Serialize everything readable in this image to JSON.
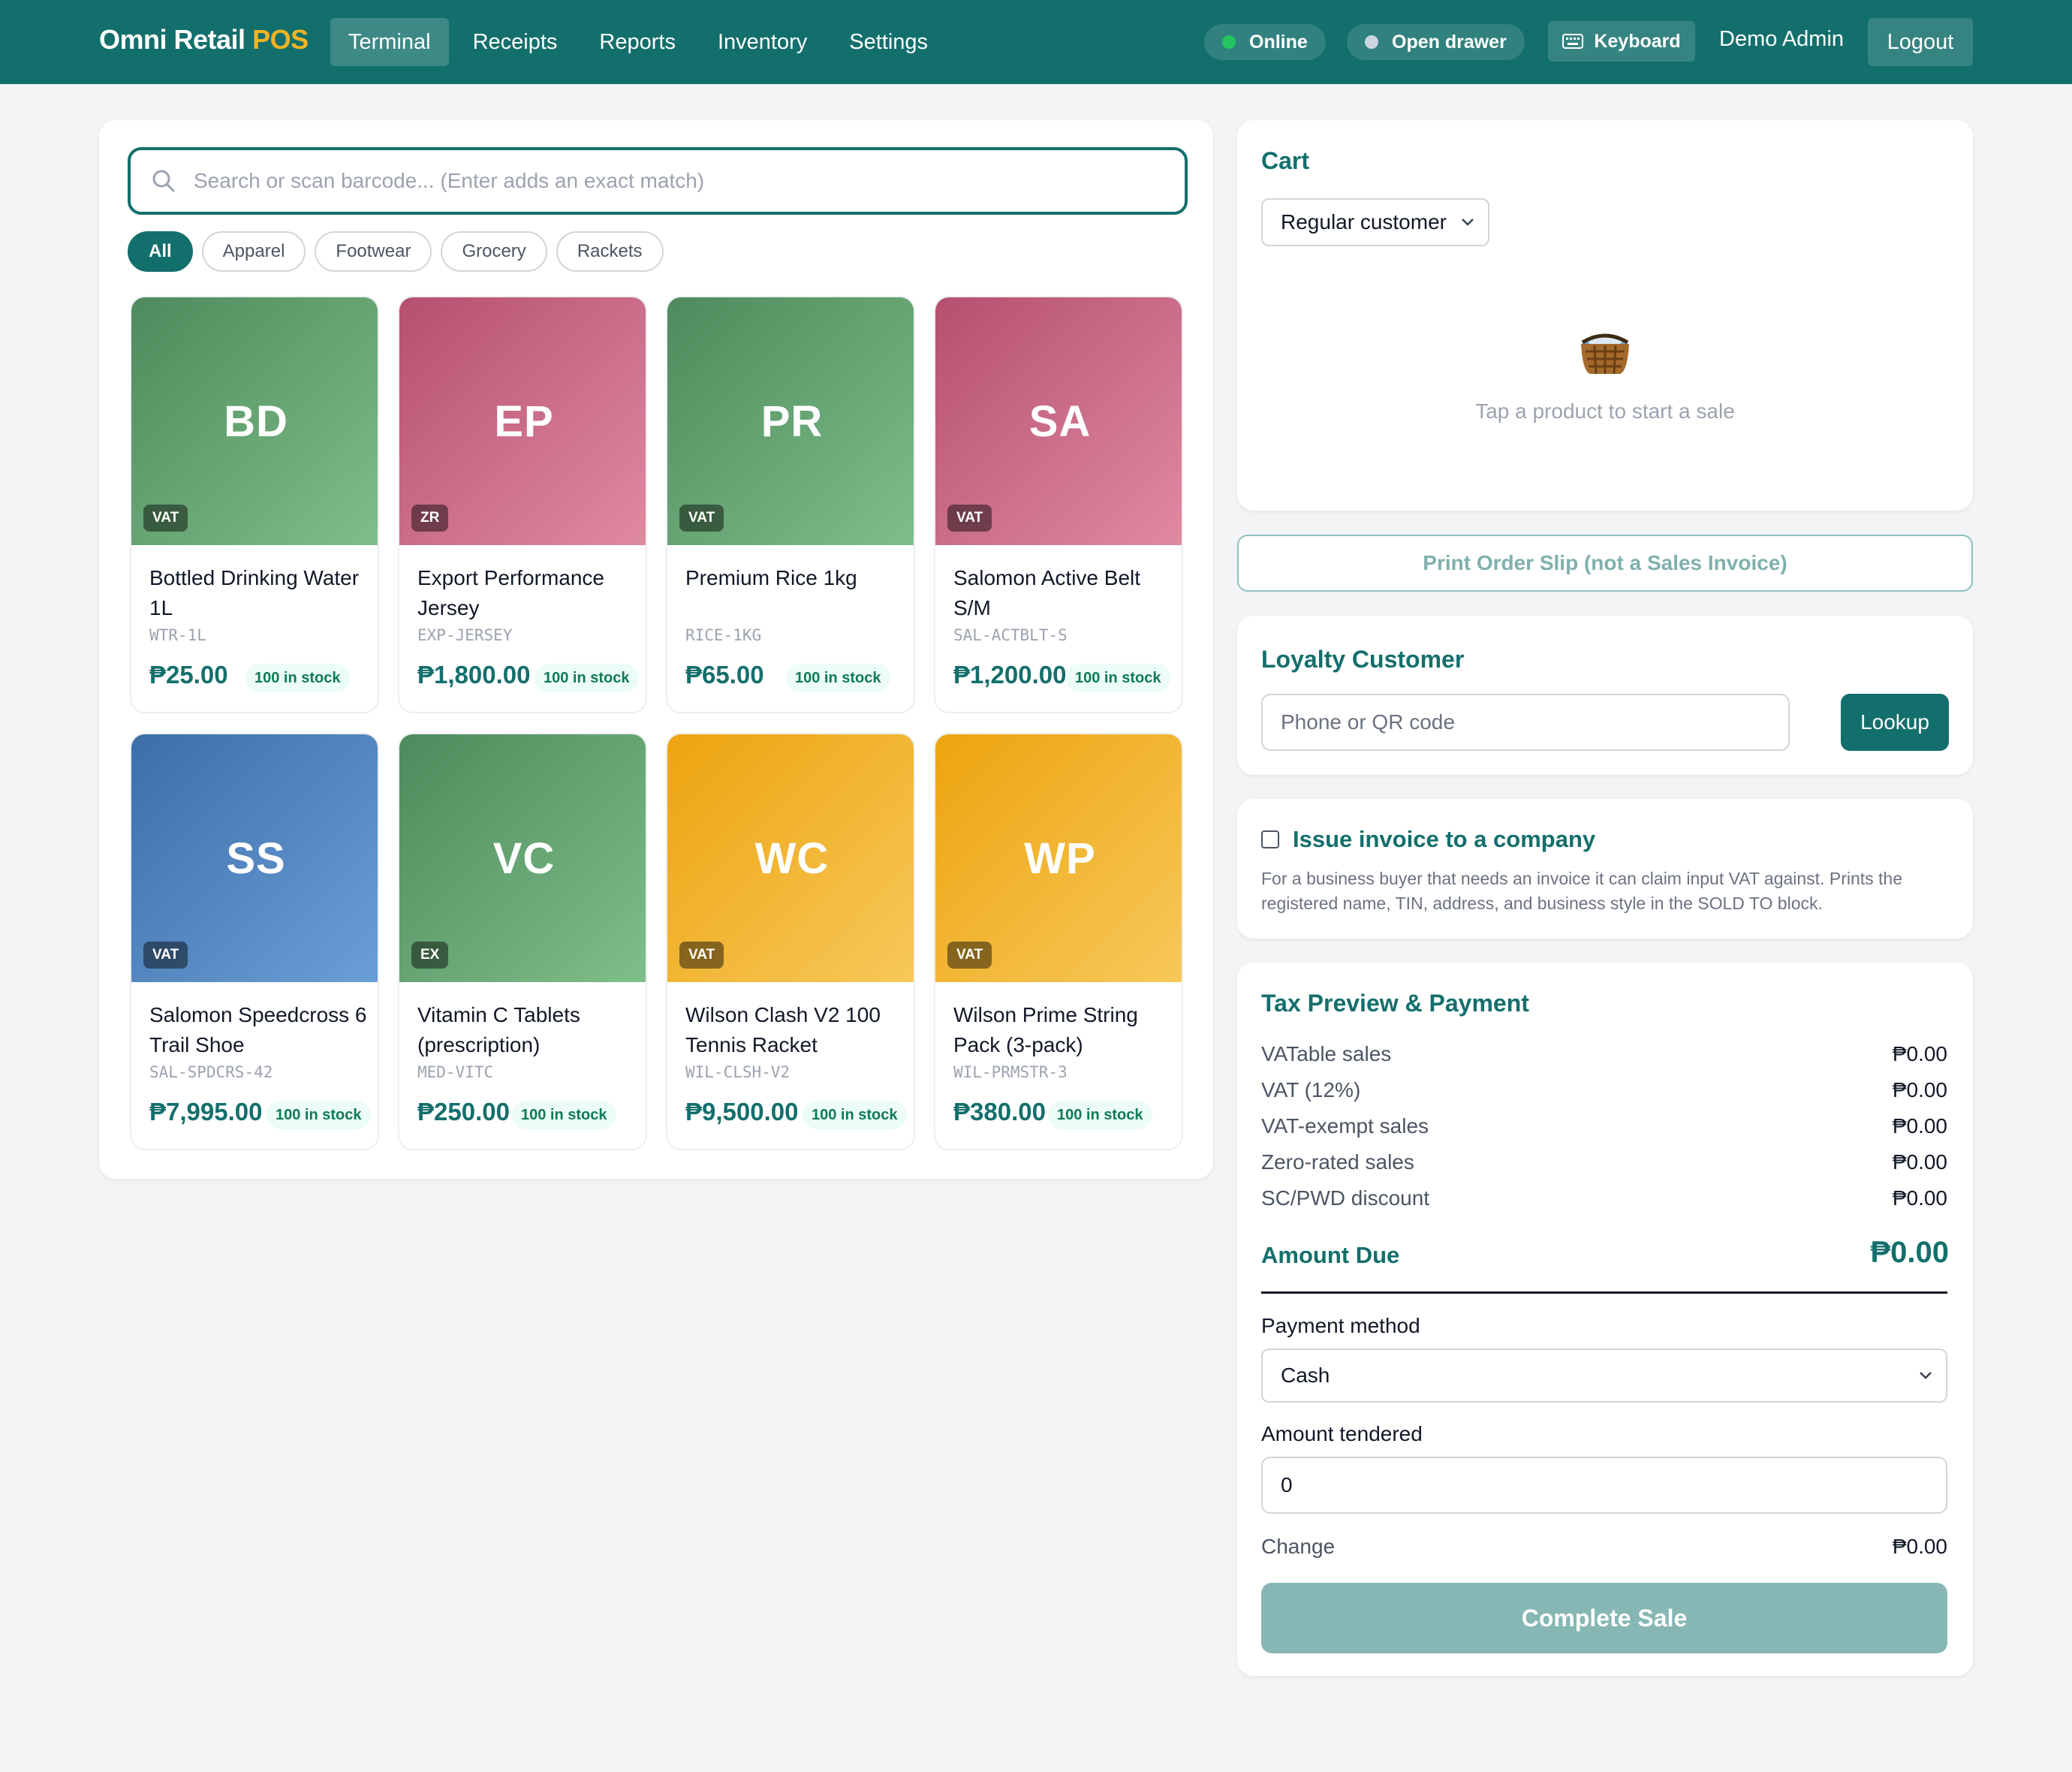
{
  "brand": {
    "name": "Omni Retail",
    "accent": "POS"
  },
  "nav": [
    {
      "label": "Terminal",
      "active": true
    },
    {
      "label": "Receipts"
    },
    {
      "label": "Reports"
    },
    {
      "label": "Inventory"
    },
    {
      "label": "Settings"
    }
  ],
  "status": {
    "online": "Online",
    "drawer": "Open drawer",
    "keyboard": "Keyboard",
    "user": "Demo Admin",
    "logout": "Logout"
  },
  "search": {
    "placeholder": "Search or scan barcode... (Enter adds an exact match)"
  },
  "categories": [
    "All",
    "Apparel",
    "Footwear",
    "Grocery",
    "Rackets"
  ],
  "products": [
    {
      "initials": "BD",
      "tax": "VAT",
      "name": "Bottled Drinking Water 1L",
      "sku": "WTR-1L",
      "price": "₱25.00",
      "stock": "100 in stock"
    },
    {
      "initials": "EP",
      "tax": "ZR",
      "name": "Export Performance Jersey",
      "sku": "EXP-JERSEY",
      "price": "₱1,800.00",
      "stock": "100 in stock"
    },
    {
      "initials": "PR",
      "tax": "VAT",
      "name": "Premium Rice 1kg",
      "sku": "RICE-1KG",
      "price": "₱65.00",
      "stock": "100 in stock"
    },
    {
      "initials": "SA",
      "tax": "VAT",
      "name": "Salomon Active Belt S/M",
      "sku": "SAL-ACTBLT-S",
      "price": "₱1,200.00",
      "stock": "100 in stock"
    },
    {
      "initials": "SS",
      "tax": "VAT",
      "name": "Salomon Speedcross 6 Trail Shoe",
      "sku": "SAL-SPDCRS-42",
      "price": "₱7,995.00",
      "stock": "100 in stock"
    },
    {
      "initials": "VC",
      "tax": "EX",
      "name": "Vitamin C Tablets (prescription)",
      "sku": "MED-VITC",
      "price": "₱250.00",
      "stock": "100 in stock"
    },
    {
      "initials": "WC",
      "tax": "VAT",
      "name": "Wilson Clash V2 100 Tennis Racket",
      "sku": "WIL-CLSH-V2",
      "price": "₱9,500.00",
      "stock": "100 in stock"
    },
    {
      "initials": "WP",
      "tax": "VAT",
      "name": "Wilson Prime String Pack (3-pack)",
      "sku": "WIL-PRMSTR-3",
      "price": "₱380.00",
      "stock": "100 in stock"
    }
  ],
  "cart": {
    "title": "Cart",
    "customer_type": "Regular customer",
    "empty_text": "Tap a product to start a sale"
  },
  "print_slip": "Print Order Slip (not a Sales Invoice)",
  "loyalty": {
    "title": "Loyalty Customer",
    "placeholder": "Phone or QR code",
    "button": "Lookup"
  },
  "company_invoice": {
    "title": "Issue invoice to a company",
    "description": "For a business buyer that needs an invoice it can claim input VAT against. Prints the registered name, TIN, address, and business style in the SOLD TO block."
  },
  "tax": {
    "title": "Tax Preview & Payment",
    "rows": [
      {
        "label": "VATable sales",
        "value": "₱0.00"
      },
      {
        "label": "VAT (12%)",
        "value": "₱0.00"
      },
      {
        "label": "VAT-exempt sales",
        "value": "₱0.00"
      },
      {
        "label": "Zero-rated sales",
        "value": "₱0.00"
      },
      {
        "label": "SC/PWD discount",
        "value": "₱0.00"
      }
    ],
    "amount_due_label": "Amount Due",
    "amount_due": "₱0.00",
    "payment_method_label": "Payment method",
    "payment_method": "Cash",
    "tendered_label": "Amount tendered",
    "tendered_value": "0",
    "change_label": "Change",
    "change_value": "₱0.00",
    "complete_button": "Complete Sale"
  },
  "colors": {
    "primary": "#136f6c",
    "accent": "#f5b324",
    "online_dot": "#22c55e",
    "drawer_dot": "#cbd5e1"
  },
  "card_themes": [
    "green",
    "pink",
    "green",
    "pink",
    "blue",
    "green",
    "amber",
    "amber"
  ]
}
